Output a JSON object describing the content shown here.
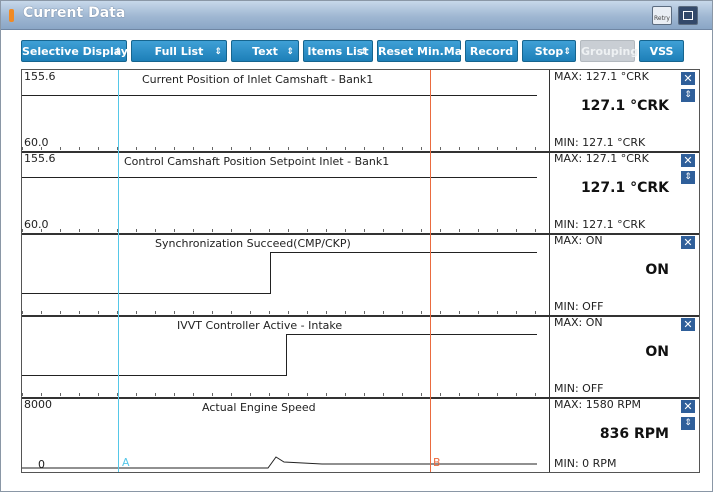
{
  "window": {
    "title": "Current Data",
    "retry_label": "Retry"
  },
  "toolbar": {
    "buttons": [
      {
        "label": "Selective Display",
        "has_dropdown": true,
        "disabled": false
      },
      {
        "label": "Full List",
        "has_dropdown": true,
        "disabled": false
      },
      {
        "label": "Text",
        "has_dropdown": true,
        "disabled": false
      },
      {
        "label": "Items List",
        "has_dropdown": true,
        "disabled": false
      },
      {
        "label": "Reset Min.Max",
        "has_dropdown": false,
        "disabled": false
      },
      {
        "label": "Record",
        "has_dropdown": false,
        "disabled": false
      },
      {
        "label": "Stop",
        "has_dropdown": true,
        "disabled": false
      },
      {
        "label": "Grouping",
        "has_dropdown": false,
        "disabled": true
      },
      {
        "label": "VSS",
        "has_dropdown": false,
        "disabled": false
      }
    ]
  },
  "panels": [
    {
      "title": "Current Position of Inlet Camshaft - Bank1",
      "y_max": "155.6",
      "y_min": "60.0",
      "max_text": "MAX: 127.1 °CRK",
      "min_text": "MIN: 127.1 °CRK",
      "value": "127.1 °CRK",
      "has_sort": true
    },
    {
      "title": "Control Camshaft Position Setpoint Inlet - Bank1",
      "y_max": "155.6",
      "y_min": "60.0",
      "max_text": "MAX: 127.1 °CRK",
      "min_text": "MIN: 127.1 °CRK",
      "value": "127.1 °CRK",
      "has_sort": true
    },
    {
      "title": "Synchronization Succeed(CMP/CKP)",
      "y_max": "",
      "y_min": "",
      "max_text": "MAX: ON",
      "min_text": "MIN: OFF",
      "value": "ON",
      "has_sort": false
    },
    {
      "title": "IVVT Controller Active - Intake",
      "y_max": "",
      "y_min": "",
      "max_text": "MAX: ON",
      "min_text": "MIN: OFF",
      "value": "ON",
      "has_sort": false
    },
    {
      "title": "Actual Engine Speed",
      "y_max": "8000",
      "y_min": "0",
      "max_text": "MAX:   1580 RPM",
      "min_text": "MIN:      0 RPM",
      "value": "836 RPM",
      "has_sort": true
    }
  ],
  "cursors": [
    {
      "label": "A",
      "color": "#55c7e8"
    },
    {
      "label": "B",
      "color": "#ea6b3f"
    }
  ],
  "colors": {
    "toolbar_button": "#1d7fb8",
    "title_bar": "#9fb7d2"
  }
}
